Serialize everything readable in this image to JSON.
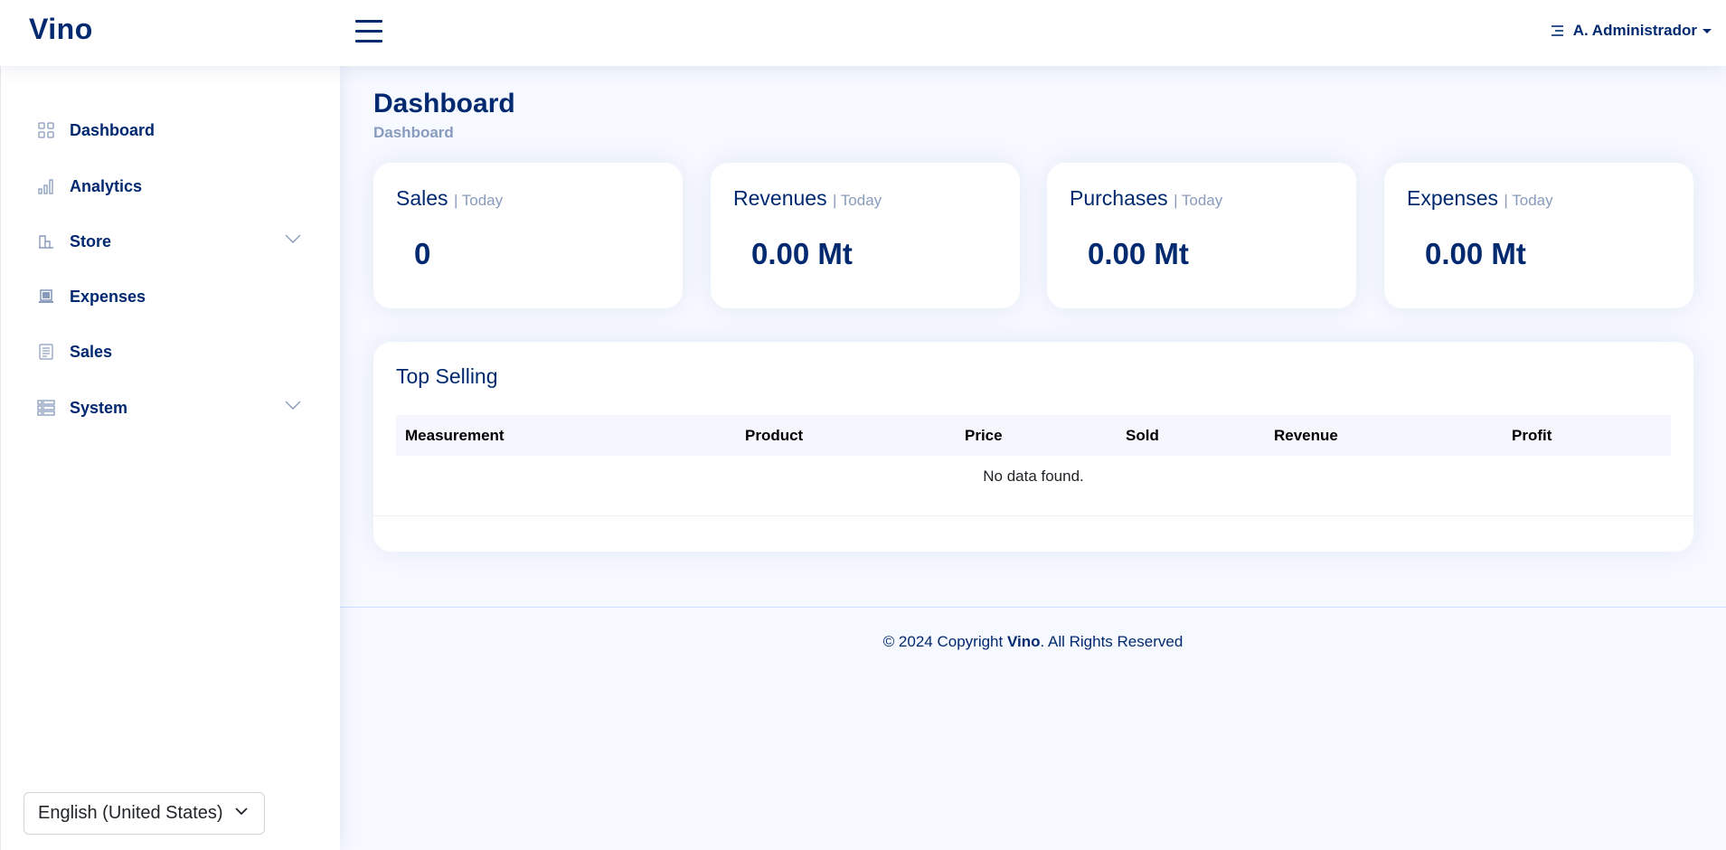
{
  "app": {
    "logo": "Vino"
  },
  "header": {
    "user_name": "A. Administrador"
  },
  "sidebar": {
    "items": [
      {
        "label": "Dashboard",
        "icon": "grid-icon"
      },
      {
        "label": "Analytics",
        "icon": "bar-chart-icon"
      },
      {
        "label": "Store",
        "icon": "shop-icon",
        "expandable": true
      },
      {
        "label": "Expenses",
        "icon": "laptop-icon"
      },
      {
        "label": "Sales",
        "icon": "receipt-icon"
      },
      {
        "label": "System",
        "icon": "server-icon",
        "expandable": true
      }
    ],
    "language": "English (United States)"
  },
  "page": {
    "title": "Dashboard",
    "breadcrumb": "Dashboard"
  },
  "stats": [
    {
      "title": "Sales",
      "period": "| Today",
      "value": "0"
    },
    {
      "title": "Revenues",
      "period": "| Today",
      "value": "0.00 Mt"
    },
    {
      "title": "Purchases",
      "period": "| Today",
      "value": "0.00 Mt"
    },
    {
      "title": "Expenses",
      "period": "| Today",
      "value": "0.00 Mt"
    }
  ],
  "top_selling": {
    "title": "Top Selling",
    "columns": [
      "Measurement",
      "Product",
      "Price",
      "Sold",
      "Revenue",
      "Profit"
    ],
    "empty_message": "No data found."
  },
  "footer": {
    "prefix": "© 2024 Copyright ",
    "brand": "Vino",
    "suffix": ". All Rights Reserved"
  },
  "colors": {
    "primary": "#012970",
    "muted": "#899bbd",
    "background": "#f6f9ff"
  }
}
